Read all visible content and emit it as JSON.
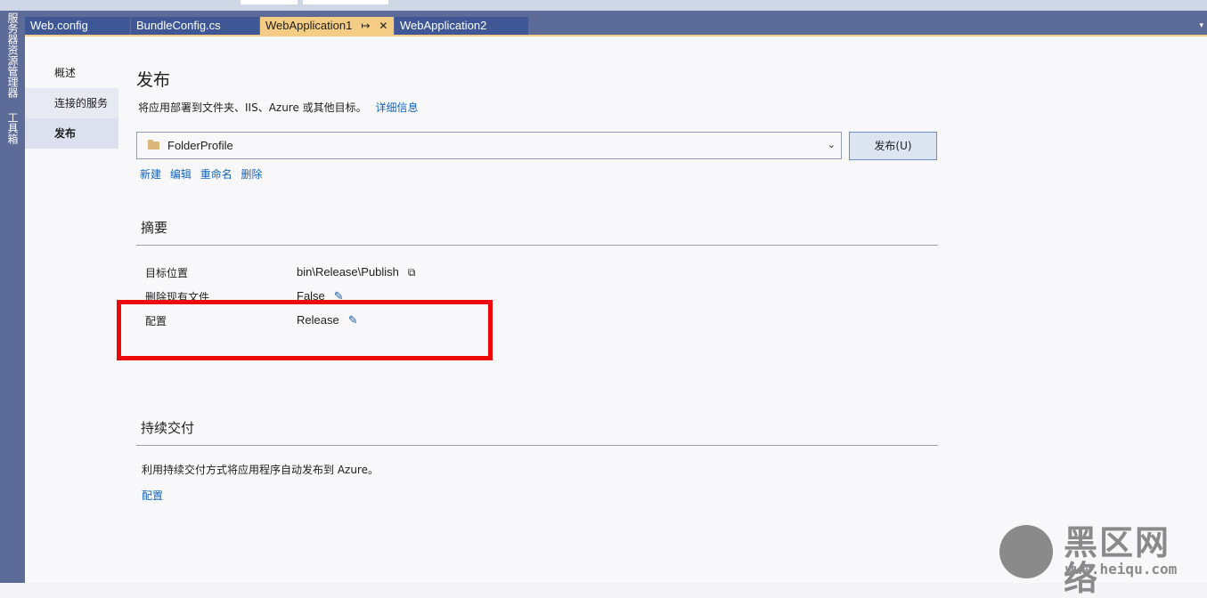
{
  "tabs": [
    {
      "label": "Web.config"
    },
    {
      "label": "BundleConfig.cs"
    },
    {
      "label": "WebApplication1",
      "active": true
    },
    {
      "label": "WebApplication2"
    }
  ],
  "left_rail": {
    "server_explorer": "服务器资源管理器",
    "toolbox": "工具箱"
  },
  "nav": {
    "items": [
      {
        "label": "概述"
      },
      {
        "label": "连接的服务"
      },
      {
        "label": "发布",
        "active": true
      }
    ]
  },
  "publish": {
    "title": "发布",
    "subtitle": "将应用部署到文件夹、IIS、Azure 或其他目标。",
    "details_link": "详细信息",
    "profile_value": "FolderProfile",
    "publish_button": "发布(U)",
    "actions": {
      "new": "新建",
      "edit": "编辑",
      "rename": "重命名",
      "delete": "删除"
    }
  },
  "summary": {
    "title": "摘要",
    "rows": [
      {
        "label": "目标位置",
        "value": "bin\\Release\\Publish"
      },
      {
        "label": "删除现有文件",
        "value": "False"
      },
      {
        "label": "配置",
        "value": "Release"
      }
    ]
  },
  "continuous_delivery": {
    "title": "持续交付",
    "description": "利用持续交付方式将应用程序自动发布到 Azure。",
    "configure_link": "配置"
  },
  "watermark": {
    "text": "黑区网络",
    "url": "www.heiqu.com"
  },
  "colors": {
    "tab_bar": "#5d6b99",
    "active_tab": "#f5cc84",
    "link": "#1464bc",
    "highlight": "#ee0a0a"
  },
  "icons": {
    "folder": "folder-icon",
    "dropdown": "chevron-down-icon",
    "copy": "copy-icon",
    "edit": "pencil-icon",
    "pin": "pin-icon",
    "close": "close-icon"
  }
}
